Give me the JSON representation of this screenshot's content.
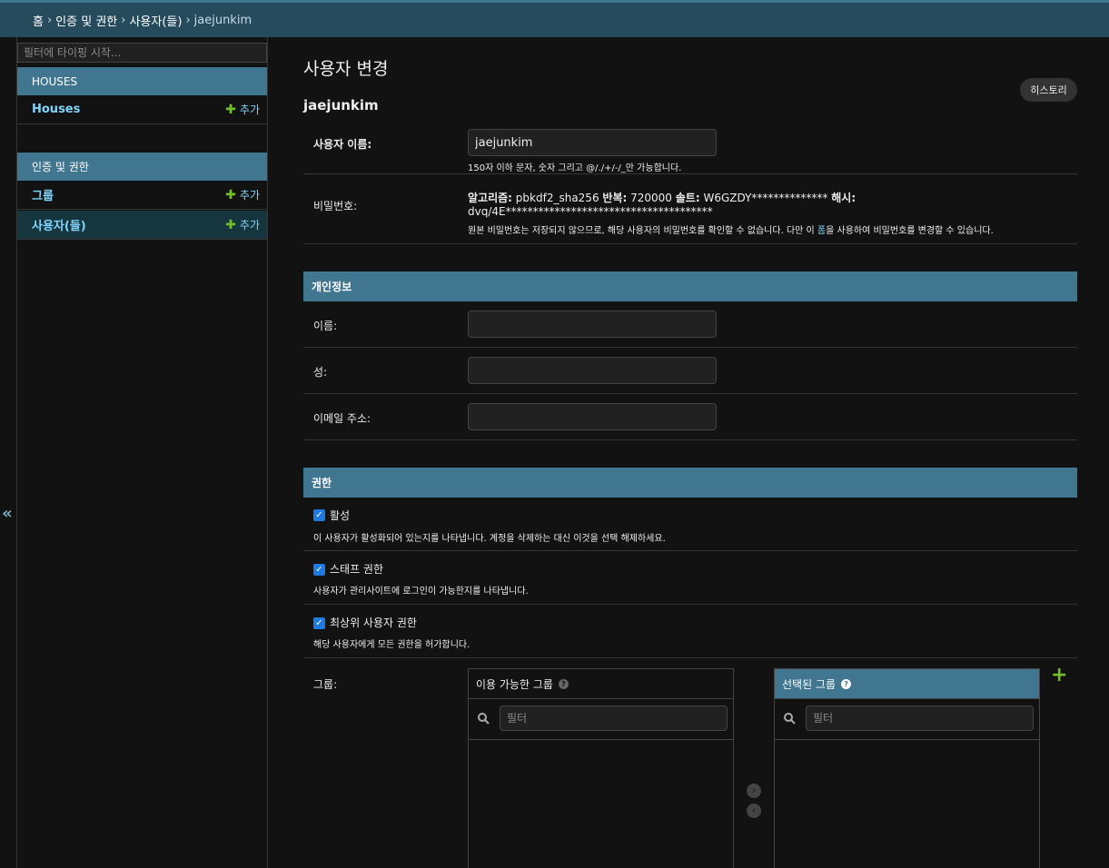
{
  "breadcrumbs": {
    "home": "홈",
    "app": "인증 및 권한",
    "model": "사용자(들)",
    "current": "jaejunkim",
    "separator": "›"
  },
  "sidebar": {
    "filter_placeholder": "필터에 타이핑 시작...",
    "collapse_label": "«",
    "apps": [
      {
        "caption": "HOUSES",
        "models": [
          {
            "name": "Houses",
            "add": "추가"
          }
        ]
      },
      {
        "caption": "인증 및 권한",
        "models": [
          {
            "name": "그룹",
            "add": "추가"
          },
          {
            "name": "사용자(들)",
            "add": "추가"
          }
        ]
      }
    ]
  },
  "page": {
    "title": "사용자 변경",
    "object_name": "jaejunkim",
    "history_button": "히스토리"
  },
  "fields": {
    "username": {
      "label": "사용자 이름:",
      "value": "jaejunkim",
      "help": "150자 이하 문자, 숫자 그리고 @/./+/-/_만 가능합니다."
    },
    "password": {
      "label": "비밀번호:",
      "algorithm_label": "알고리즘:",
      "algorithm_value": "pbkdf2_sha256",
      "iterations_label": "반복:",
      "iterations_value": "720000",
      "salt_label": "솔트:",
      "salt_value": "W6GZDY**************",
      "hash_label": "해시:",
      "hash_value": "dvq/4E**************************************",
      "help_before": "원본 비밀번호는 저장되지 않으므로, 해당 사용자의 비밀번호를 확인할 수 없습니다. 다만 이 ",
      "help_link": "폼",
      "help_after": "을 사용하여 비밀번호를 변경할 수 있습니다."
    }
  },
  "personal": {
    "caption": "개인정보",
    "first_name_label": "이름:",
    "last_name_label": "성:",
    "email_label": "이메일 주소:"
  },
  "permissions": {
    "caption": "권한",
    "active": {
      "label": "활성",
      "checked": true,
      "help": "이 사용자가 활성화되어 있는지를 나타냅니다. 계정을 삭제하는 대신 이것을 선택 해제하세요."
    },
    "staff": {
      "label": "스태프 권한",
      "checked": true,
      "help": "사용자가 관리사이트에 로그인이 가능한지를 나타냅니다."
    },
    "superuser": {
      "label": "최상위 사용자 권한",
      "checked": true,
      "help": "해당 사용자에게 모든 권한을 허가합니다."
    },
    "groups_label": "그룹:",
    "available_title": "이용 가능한 그룹",
    "chosen_title": "선택된 그룹",
    "filter_placeholder": "필터",
    "help_glyph": "?",
    "add_glyph": "+"
  },
  "icons": {
    "search": "search-icon",
    "checkbox": "checkmark-icon",
    "arrow_right": "arrow-right-circle-icon",
    "arrow_left": "arrow-left-circle-icon",
    "plus": "plus-icon"
  },
  "colors": {
    "breadcrumb_bg": "#264b5d",
    "module_caption_bg": "#417690",
    "link": "#81d4fa",
    "add_green": "#70bf2b",
    "checkbox_blue": "#1e7ae0"
  }
}
